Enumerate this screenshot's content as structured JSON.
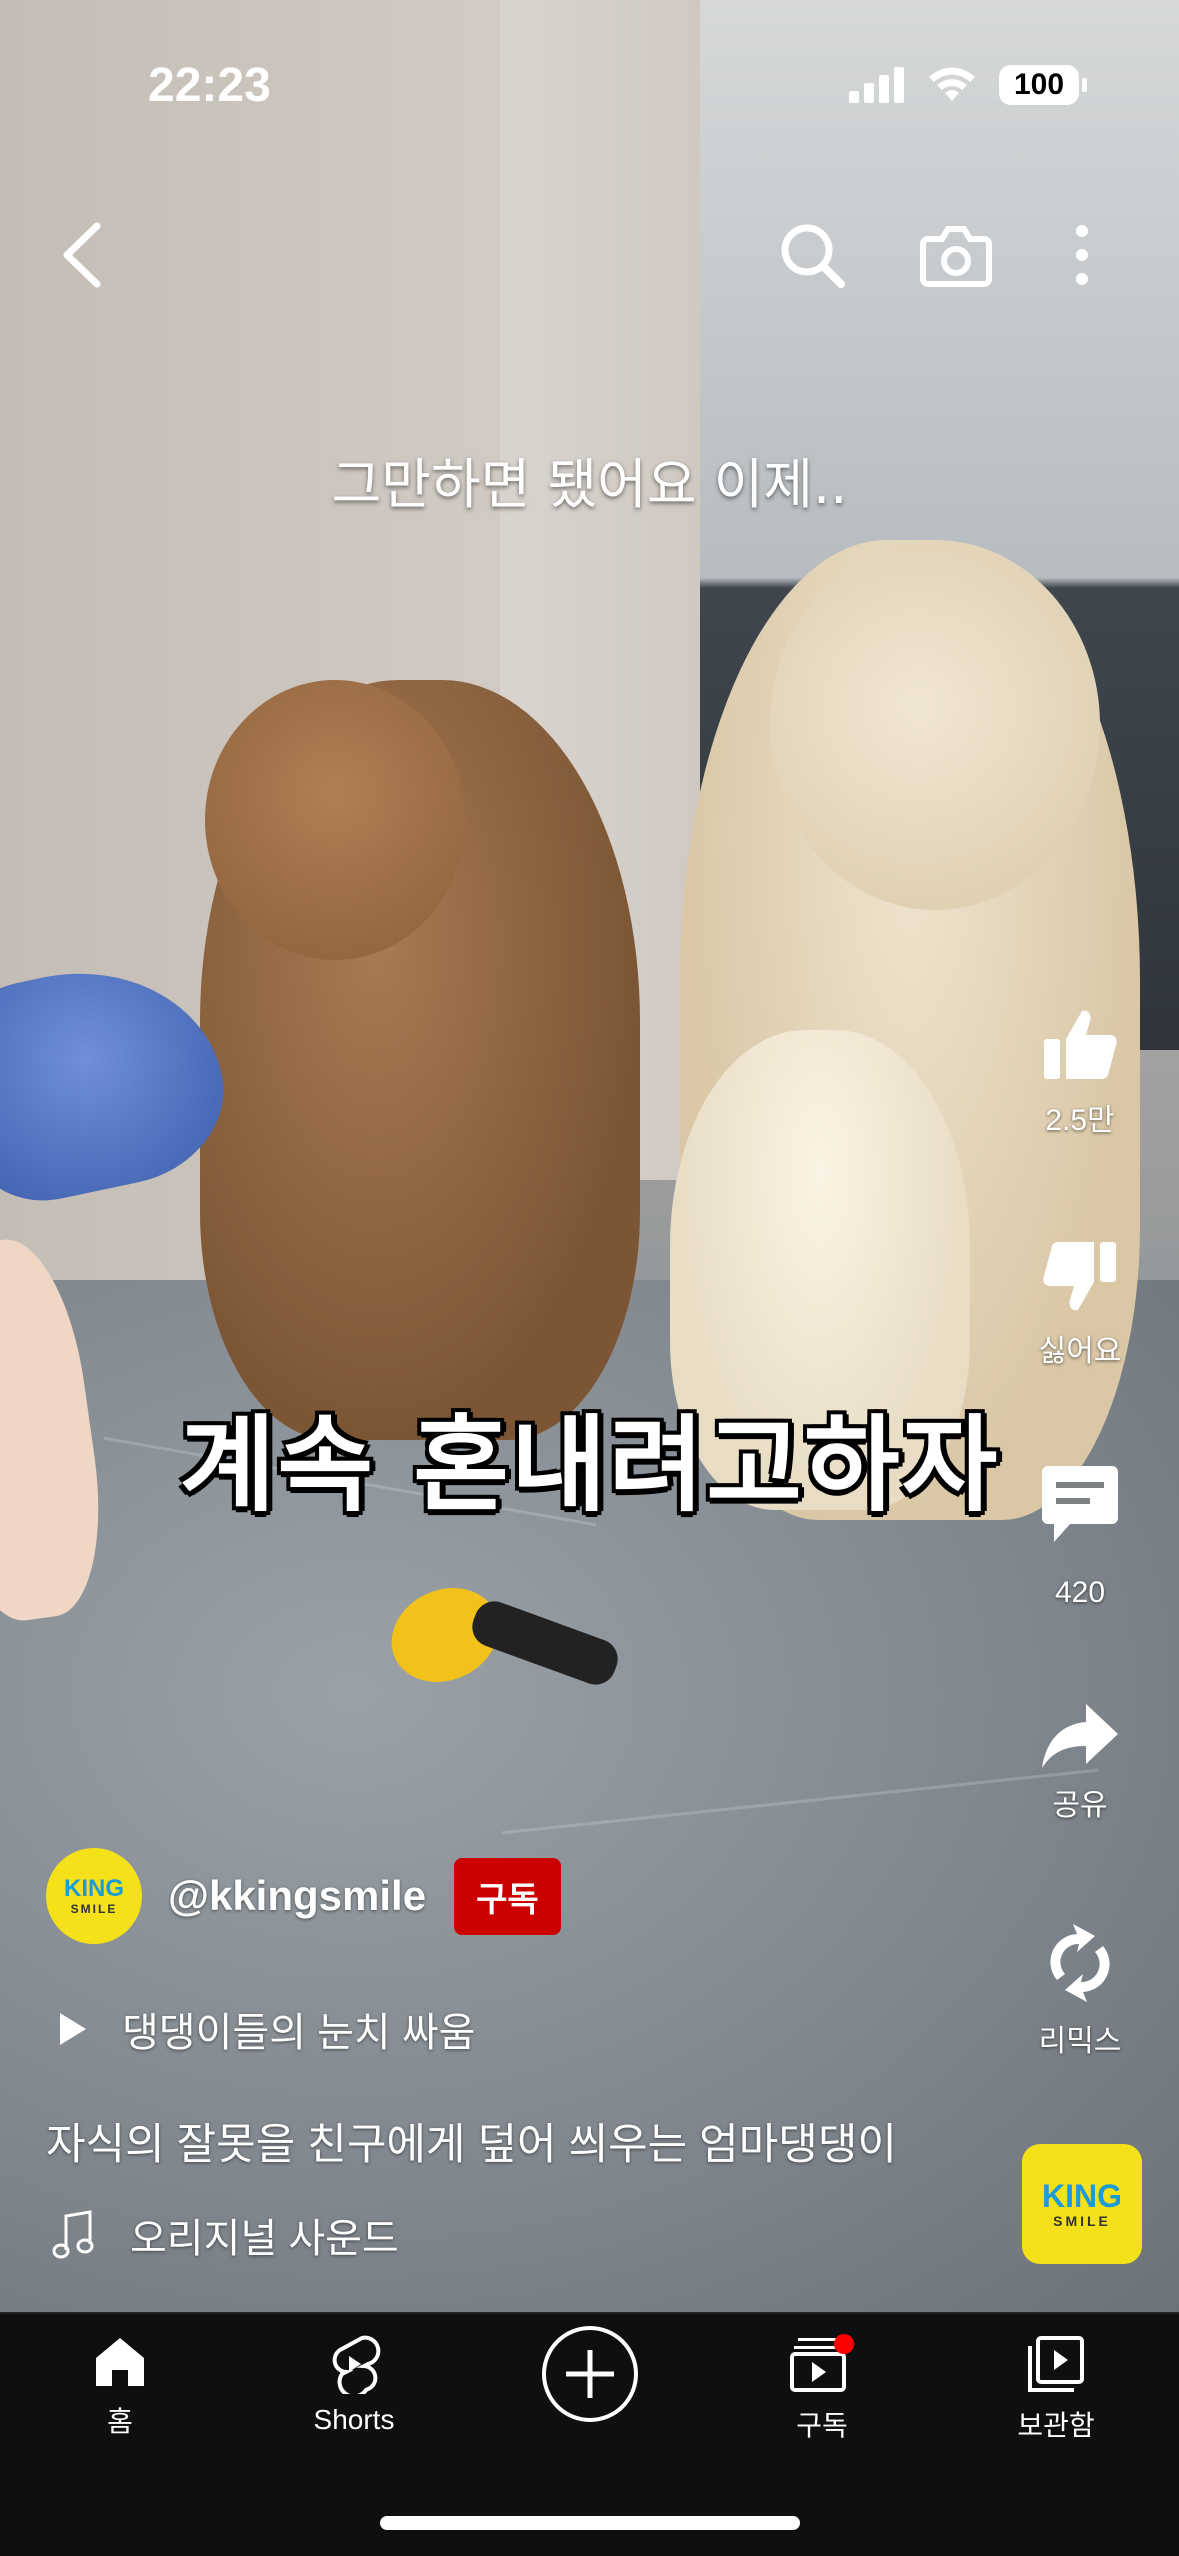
{
  "status_bar": {
    "time": "22:23",
    "battery": "100"
  },
  "video": {
    "caption_top": "그만하면 됐어요 이제..",
    "caption_main": "계속 혼내려고하자"
  },
  "actions": {
    "like_count": "2.5만",
    "dislike_label": "싫어요",
    "comment_count": "420",
    "share_label": "공유",
    "remix_label": "리믹스"
  },
  "channel": {
    "handle": "@kkingsmile",
    "subscribe_label": "구독",
    "avatar_text": "KING",
    "avatar_subtext": "SMILE"
  },
  "playlist": {
    "title": "댕댕이들의 눈치 싸움"
  },
  "video_title": "자식의 잘못을 친구에게 덮어 씌우는 엄마댕댕이",
  "sound": {
    "label": "오리지널 사운드"
  },
  "nav": {
    "home": "홈",
    "shorts": "Shorts",
    "subscriptions": "구독",
    "library": "보관함"
  },
  "colors": {
    "subscribe": "#cc0000",
    "notification_dot": "#ff0000",
    "brand_yellow": "#f5e11a"
  },
  "icons": [
    "back-icon",
    "search-icon",
    "camera-icon",
    "more-icon",
    "like-icon",
    "dislike-icon",
    "comment-icon",
    "share-icon",
    "remix-icon",
    "play-icon",
    "music-note-icon",
    "home-icon",
    "shorts-icon",
    "create-icon",
    "subscriptions-icon",
    "library-icon"
  ]
}
